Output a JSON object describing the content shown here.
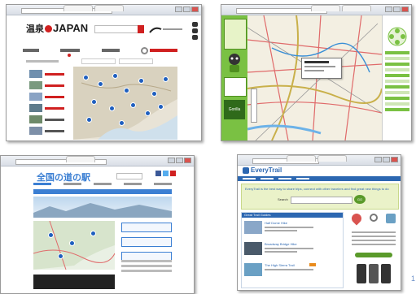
{
  "page_number": "1",
  "shots": {
    "s1": {
      "brand_prefix": "温泉",
      "brand_suffix": "JAPAN",
      "menu": [
        "",
        "",
        ""
      ],
      "nav": [
        "",
        "",
        ""
      ],
      "accent": "#d02020"
    },
    "s2": {
      "side_brand": "Gorilla",
      "accent": "#7ac143"
    },
    "s3": {
      "logo": "全国の道の駅",
      "buttons": [
        "",
        "",
        ""
      ],
      "accent": "#3b7fd3"
    },
    "s4": {
      "logo": "EveryTrail",
      "intro": "EveryTrail is the best way to share trips, connect with other travelers and find great new things to do",
      "search_label": "Search",
      "go_label": "GO",
      "section_title": "Great Trail Guides",
      "items": [
        "Half Dome Hike",
        "Broadway Bridge Hike",
        "The High Sierra Trail"
      ],
      "accent": "#2c67b1"
    }
  }
}
